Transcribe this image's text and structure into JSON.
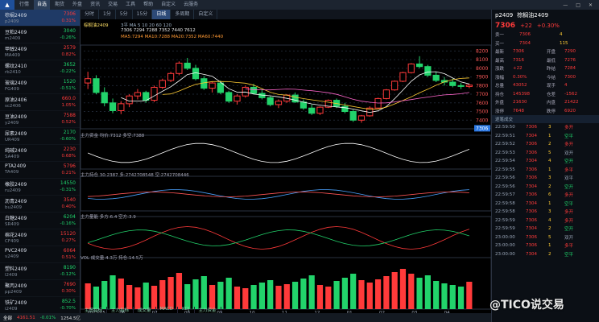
{
  "menu": [
    "行情",
    "自选",
    "期货",
    "外盘",
    "资讯",
    "交易",
    "工具",
    "帮助",
    "自定义",
    "云服务"
  ],
  "active_menu": 1,
  "chart_tabs": [
    "分时",
    "1分",
    "5分",
    "15分",
    "日线",
    "多周期",
    "自定义"
  ],
  "active_tab": 4,
  "instrument": {
    "code": "p2409",
    "name": "棕榈油2409"
  },
  "watchlist": [
    {
      "name": "棕榈2409",
      "code": "p2409",
      "price": "7306",
      "change": "0.31%",
      "dir": "up"
    },
    {
      "name": "豆粕2409",
      "code": "m2409",
      "price": "3040",
      "change": "-0.26%",
      "dir": "dn"
    },
    {
      "name": "甲醇2409",
      "code": "MA409",
      "price": "2579",
      "change": "0.82%",
      "dir": "up"
    },
    {
      "name": "螺纹2410",
      "code": "rb2410",
      "price": "3652",
      "change": "-0.22%",
      "dir": "dn"
    },
    {
      "name": "玻璃2409",
      "code": "FG409",
      "price": "1520",
      "change": "-0.51%",
      "dir": "dn"
    },
    {
      "name": "原油2406",
      "code": "sc2406",
      "price": "660.0",
      "change": "1.05%",
      "dir": "up"
    },
    {
      "name": "豆油2409",
      "code": "y2409",
      "price": "7588",
      "change": "0.52%",
      "dir": "up"
    },
    {
      "name": "尿素2409",
      "code": "UR409",
      "price": "2170",
      "change": "-0.60%",
      "dir": "dn"
    },
    {
      "name": "纯碱2409",
      "code": "SA409",
      "price": "2230",
      "change": "0.68%",
      "dir": "up"
    },
    {
      "name": "PTA2409",
      "code": "TA409",
      "price": "5796",
      "change": "0.21%",
      "dir": "up"
    },
    {
      "name": "橡胶2409",
      "code": "ru2409",
      "price": "14550",
      "change": "-0.31%",
      "dir": "dn"
    },
    {
      "name": "沥青2409",
      "code": "bu2409",
      "price": "3540",
      "change": "0.40%",
      "dir": "up"
    },
    {
      "name": "白糖2409",
      "code": "SR409",
      "price": "6204",
      "change": "-0.16%",
      "dir": "dn"
    },
    {
      "name": "棉花2409",
      "code": "CF409",
      "price": "15120",
      "change": "0.27%",
      "dir": "up"
    },
    {
      "name": "PVC2409",
      "code": "v2409",
      "price": "6064",
      "change": "0.51%",
      "dir": "up"
    },
    {
      "name": "塑料2409",
      "code": "l2409",
      "price": "8190",
      "change": "-0.12%",
      "dir": "dn"
    },
    {
      "name": "聚丙2409",
      "code": "pp2409",
      "price": "7690",
      "change": "0.30%",
      "dir": "up"
    },
    {
      "name": "铁矿2409",
      "code": "i2409",
      "price": "852.5",
      "change": "-0.70%",
      "dir": "dn"
    }
  ],
  "chart_info": {
    "title": "棕榈油2409",
    "l1": "3平 MA 5 10 20 60 120",
    "l2": "7306 7294 7288 7352 7440 7612",
    "main": "MA5:7294 MA10:7288 MA20:7352 MA60:7440"
  },
  "indicators": [
    {
      "label": "主力资金 均价:7312  多空:7388",
      "color": "#d7ccc8"
    },
    {
      "label": "主力持仓 30:2387  多:2742708548  空:2742708446",
      "color": "#e4e4e4"
    },
    {
      "label": "主力量能 多方:6.4  空方:3.9",
      "color": "#e4e4e4"
    },
    {
      "label": "VOL 成交量:4.3万 持仓:14.5万",
      "color": "#e4e4e4"
    }
  ],
  "xaxis": [
    "2023/05",
    "06",
    "07",
    "08",
    "09",
    "10",
    "11",
    "12",
    "01",
    "02",
    "03",
    "04"
  ],
  "bottom_tabs": [
    "主图指标",
    "主力指标",
    "成交量",
    "MACD",
    "KDJ",
    "主力资金"
  ],
  "status": {
    "label": "全部",
    "val1": "4161.51",
    "val2": "-0.01%",
    "val3": "1254.5亿"
  },
  "quote": {
    "code": "p2409",
    "name": "棕榈油2409",
    "price": "7306",
    "change": "+22",
    "pct": "+0.30%"
  },
  "ob": {
    "ask": "7306",
    "ask_vol": "4",
    "bid": "7304",
    "bid_vol": "115"
  },
  "stats": [
    [
      "最新",
      "7306",
      "开盘",
      "7290"
    ],
    [
      "最高",
      "7316",
      "最低",
      "7276"
    ],
    [
      "涨跌",
      "+22",
      "昨结",
      "7284"
    ],
    [
      "涨幅",
      "0.30%",
      "今结",
      "7300"
    ],
    [
      "总量",
      "43052",
      "现手",
      "4"
    ],
    [
      "持仓",
      "145398",
      "仓差",
      "-1562"
    ],
    [
      "外盘",
      "21630",
      "内盘",
      "21422"
    ],
    [
      "涨停",
      "7648",
      "跌停",
      "6920"
    ]
  ],
  "ticks_hdr": "逐笔成交",
  "ticks": [
    [
      "22:59:50",
      "7306",
      "3",
      "多开"
    ],
    [
      "22:59:51",
      "7304",
      "1",
      "空平"
    ],
    [
      "22:59:52",
      "7306",
      "2",
      "多开"
    ],
    [
      "22:59:53",
      "7306",
      "5",
      "双开"
    ],
    [
      "22:59:54",
      "7304",
      "4",
      "空开"
    ],
    [
      "22:59:55",
      "7306",
      "1",
      "多平"
    ],
    [
      "22:59:56",
      "7306",
      "3",
      "双平"
    ],
    [
      "22:59:56",
      "7304",
      "2",
      "空开"
    ],
    [
      "22:59:57",
      "7306",
      "6",
      "多开"
    ],
    [
      "22:59:58",
      "7304",
      "1",
      "空平"
    ],
    [
      "22:59:58",
      "7306",
      "3",
      "多开"
    ],
    [
      "22:59:59",
      "7306",
      "4",
      "多开"
    ],
    [
      "22:59:59",
      "7304",
      "2",
      "空开"
    ],
    [
      "23:00:00",
      "7306",
      "5",
      "双开"
    ],
    [
      "23:00:00",
      "7306",
      "1",
      "多平"
    ],
    [
      "23:00:00",
      "7304",
      "2",
      "空平"
    ]
  ],
  "watermark": "@TICO说交易",
  "chart_data": {
    "type": "candlestick",
    "ohlc": [
      [
        7830,
        7960,
        7760,
        7880
      ],
      [
        7880,
        7920,
        7700,
        7720
      ],
      [
        7720,
        7780,
        7560,
        7600
      ],
      [
        7600,
        7650,
        7480,
        7510
      ],
      [
        7510,
        7620,
        7470,
        7590
      ],
      [
        7590,
        7700,
        7550,
        7680
      ],
      [
        7680,
        7760,
        7640,
        7720
      ],
      [
        7720,
        7740,
        7600,
        7630
      ],
      [
        7630,
        7800,
        7610,
        7780
      ],
      [
        7780,
        7880,
        7760,
        7860
      ],
      [
        7860,
        7960,
        7840,
        7940
      ],
      [
        7940,
        8080,
        7920,
        8060
      ],
      [
        8060,
        8120,
        7980,
        8000
      ],
      [
        8000,
        8040,
        7860,
        7880
      ],
      [
        7880,
        7910,
        7750,
        7770
      ],
      [
        7770,
        7850,
        7720,
        7830
      ],
      [
        7830,
        7860,
        7700,
        7720
      ],
      [
        7720,
        7740,
        7600,
        7620
      ],
      [
        7620,
        7700,
        7580,
        7680
      ],
      [
        7680,
        7800,
        7660,
        7780
      ],
      [
        7780,
        7820,
        7700,
        7710
      ],
      [
        7710,
        7760,
        7640,
        7660
      ],
      [
        7660,
        7680,
        7560,
        7580
      ],
      [
        7580,
        7640,
        7540,
        7620
      ],
      [
        7620,
        7700,
        7600,
        7690
      ],
      [
        7690,
        7720,
        7600,
        7610
      ],
      [
        7610,
        7640,
        7520,
        7540
      ],
      [
        7540,
        7580,
        7460,
        7480
      ],
      [
        7480,
        7560,
        7460,
        7550
      ],
      [
        7550,
        7640,
        7540,
        7630
      ],
      [
        7630,
        7650,
        7540,
        7560
      ],
      [
        7560,
        7600,
        7480,
        7500
      ],
      [
        7500,
        7520,
        7380,
        7400
      ],
      [
        7400,
        7460,
        7370,
        7450
      ],
      [
        7450,
        7560,
        7440,
        7540
      ],
      [
        7540,
        7660,
        7530,
        7650
      ],
      [
        7650,
        7760,
        7640,
        7750
      ],
      [
        7750,
        7860,
        7740,
        7850
      ],
      [
        7850,
        7960,
        7840,
        7950
      ],
      [
        7950,
        8060,
        7940,
        8050
      ],
      [
        8050,
        8140,
        8000,
        8020
      ],
      [
        8020,
        8040,
        7900,
        7920
      ],
      [
        7920,
        7960,
        7840,
        7860
      ],
      [
        7860,
        7900,
        7800,
        7840
      ],
      [
        7840,
        7880,
        7780,
        7800
      ],
      [
        7800,
        7830,
        7760,
        7790
      ],
      [
        7790,
        7820,
        7770,
        7806
      ]
    ],
    "ylim": [
      7300,
      8250
    ],
    "yticks": [
      7400,
      7500,
      7600,
      7700,
      7800,
      7900,
      8000,
      8100,
      8200
    ],
    "volumes": [
      32,
      28,
      35,
      42,
      38,
      30,
      27,
      33,
      29,
      36,
      40,
      45,
      31,
      37,
      41,
      30,
      34,
      39,
      28,
      26,
      30,
      33,
      36,
      29,
      31,
      34,
      38,
      42,
      30,
      28,
      35,
      39,
      44,
      36,
      33,
      37,
      41,
      46,
      50,
      44,
      39,
      42,
      35,
      32,
      30,
      28,
      34
    ]
  }
}
